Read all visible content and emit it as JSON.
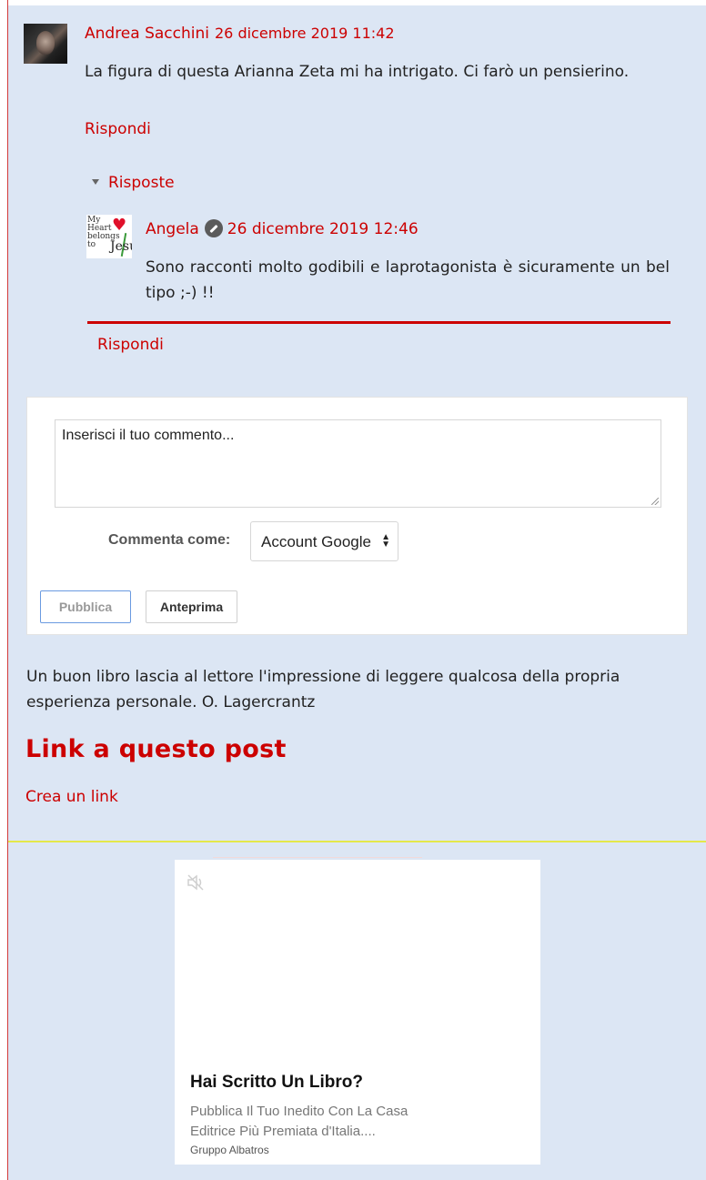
{
  "comment1": {
    "author": "Andrea Sacchini",
    "date": "26 dicembre 2019 11:42",
    "body": "La figura di questa Arianna Zeta mi ha intrigato. Ci farò un pensierino.",
    "reply_label": "Rispondi"
  },
  "replies": {
    "toggle_label": "Risposte",
    "items": [
      {
        "author": "Angela",
        "date": "26 dicembre 2019 12:46",
        "body": "Sono racconti molto godibili e laprotagonista è sicuramente un bel tipo ;-) !!",
        "avatar_text_1": "My Heart belongs to",
        "avatar_text_2": "Jesus"
      }
    ],
    "reply_label": "Rispondi"
  },
  "comment_form": {
    "placeholder": "Inserisci il tuo commento...",
    "comment_as_label": "Commenta come:",
    "comment_as_value": "Account Google",
    "publish_label": "Pubblica",
    "preview_label": "Anteprima"
  },
  "quote": "Un buon libro lascia al lettore l'impressione di leggere qualcosa della propria esperienza personale. O. Lagercrantz",
  "links_section": {
    "title": "Link a questo post",
    "create_link_label": "Crea un link"
  },
  "ad": {
    "title": "Hai Scritto Un Libro?",
    "description_line1": "Pubblica Il Tuo Inedito Con La Casa",
    "description_line2": "Editrice Più Premiata d'Italia....",
    "source": "Gruppo Albatros"
  },
  "colors": {
    "accent": "#cc0000",
    "background": "#dce6f4",
    "divider_yellow": "#e4e84a"
  }
}
